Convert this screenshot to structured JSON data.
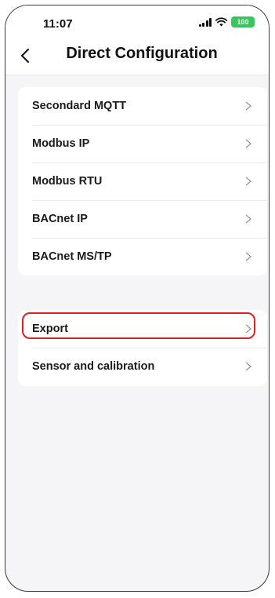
{
  "status_bar": {
    "time": "11:07",
    "battery": "100"
  },
  "header": {
    "title": "Direct Configuration"
  },
  "groups": [
    {
      "items": [
        "Secondard MQTT",
        "Modbus IP",
        "Modbus RTU",
        "BACnet IP",
        "BACnet MS/TP"
      ]
    },
    {
      "items": [
        "Export",
        "Sensor and calibration"
      ]
    }
  ],
  "highlighted_item": "Export",
  "colors": {
    "background": "#f5f5f7",
    "card": "#ffffff",
    "highlight": "#e02020",
    "battery": "#34c759"
  }
}
